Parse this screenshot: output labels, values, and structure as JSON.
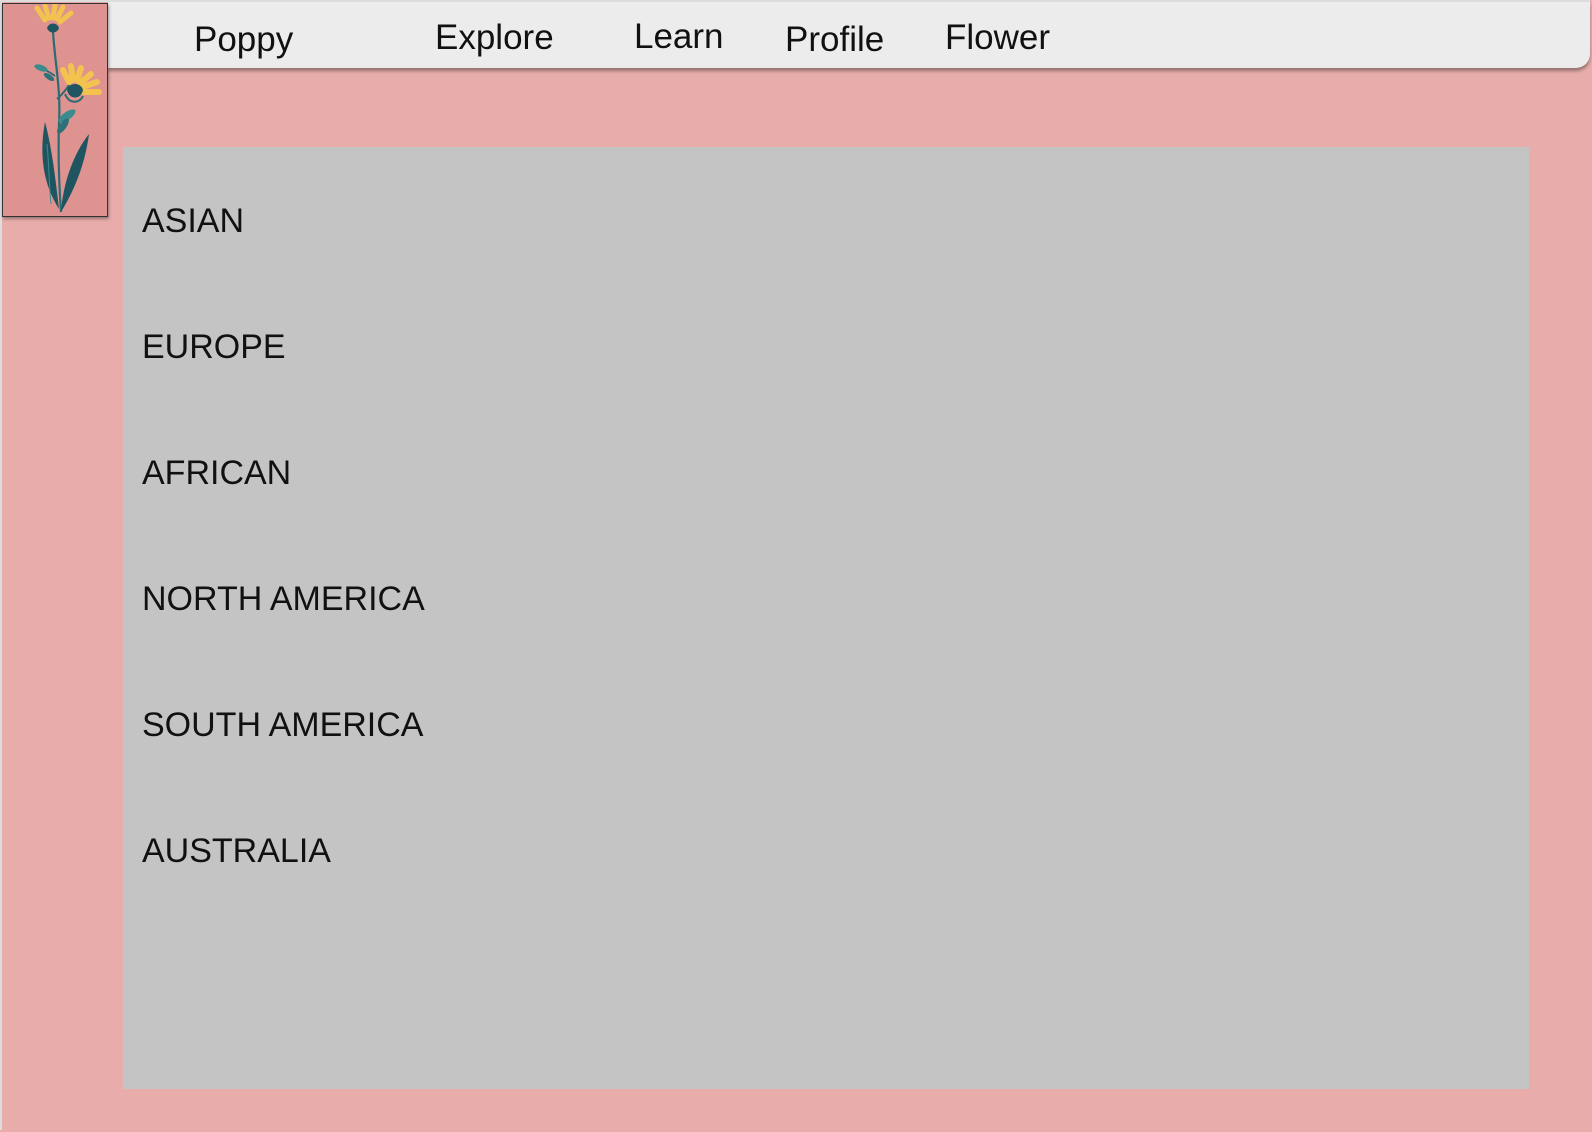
{
  "nav": {
    "brand": "Poppy",
    "items": [
      {
        "label": "Explore"
      },
      {
        "label": "Learn"
      },
      {
        "label": "Profile"
      },
      {
        "label": "Flower"
      }
    ]
  },
  "logo": {
    "icon": "flower-illustration-icon"
  },
  "regions": [
    {
      "label": "ASIAN"
    },
    {
      "label": "EUROPE"
    },
    {
      "label": "AFRICAN"
    },
    {
      "label": "NORTH AMERICA"
    },
    {
      "label": "SOUTH AMERICA"
    },
    {
      "label": "AUSTRALIA"
    }
  ],
  "colors": {
    "background": "#e8adab",
    "navbar": "#ececec",
    "panel": "#c4c4c4",
    "logo_bg": "#de9390",
    "petal": "#f2c34e",
    "leaf": "#1f5560"
  }
}
